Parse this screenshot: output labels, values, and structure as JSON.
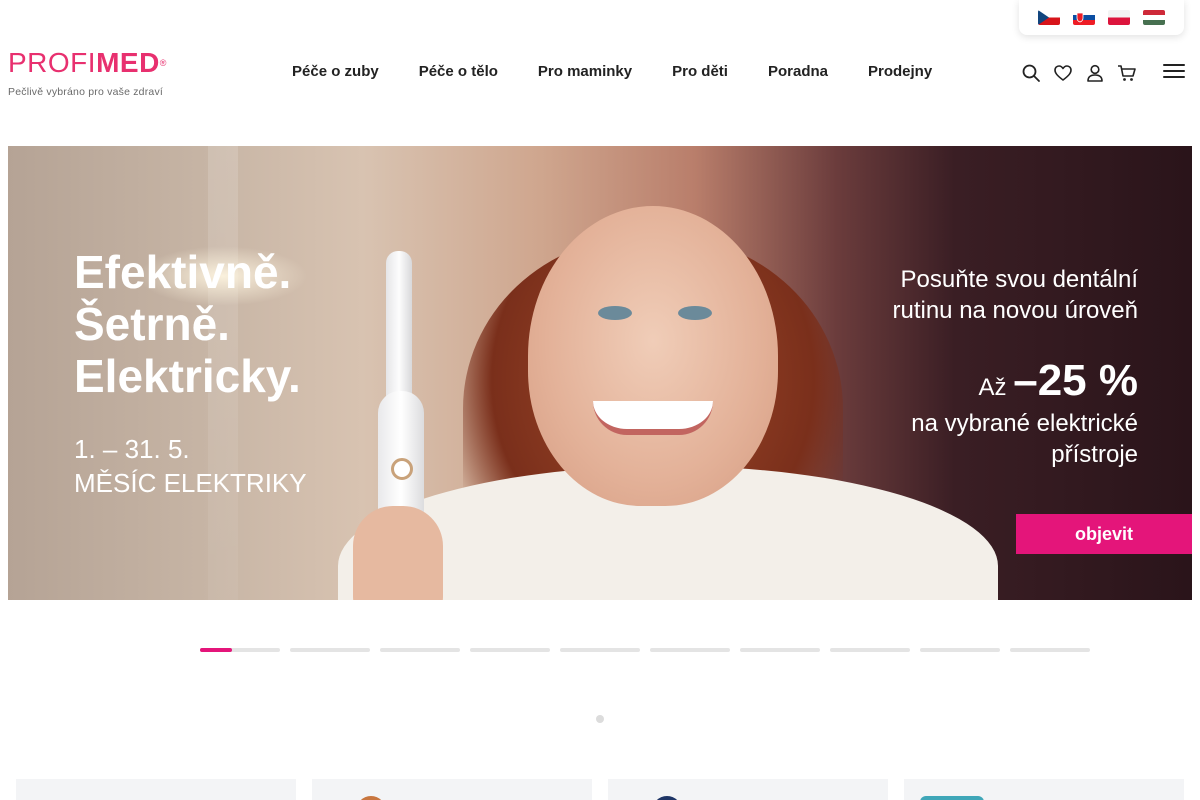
{
  "languages": [
    {
      "name": "cs-flag-icon"
    },
    {
      "name": "sk-flag-icon"
    },
    {
      "name": "pl-flag-icon"
    },
    {
      "name": "hu-flag-icon"
    }
  ],
  "logo": {
    "thin": "PROFI",
    "bold": "MED",
    "registered": "®",
    "tagline": "Pečlivě vybráno pro vaše zdraví"
  },
  "nav": {
    "items": [
      "Péče o zuby",
      "Péče o tělo",
      "Pro maminky",
      "Pro děti",
      "Poradna",
      "Prodejny"
    ]
  },
  "tools": [
    "search-icon",
    "heart-icon",
    "user-icon",
    "cart-icon",
    "menu-icon"
  ],
  "hero": {
    "title_1": "Efektivně.",
    "title_2": "Šetrně.",
    "title_3": "Elektricky.",
    "dates": "1. – 31. 5.",
    "campaign": "MĚSÍC ELEKTRIKY",
    "sub_1": "Posuňte svou dentální",
    "sub_2": "rutinu na novou úroveň",
    "disc_prefix": "Až",
    "disc_value": "–25 %",
    "after_1": "na vybrané elektrické",
    "after_2": "přístroje",
    "cta": "objevit"
  },
  "slider": {
    "count": 10,
    "active_index": 0,
    "active_progress": 0.4
  },
  "colors": {
    "brand": "#e8306f",
    "accent": "#e4157a",
    "text": "#222222"
  }
}
